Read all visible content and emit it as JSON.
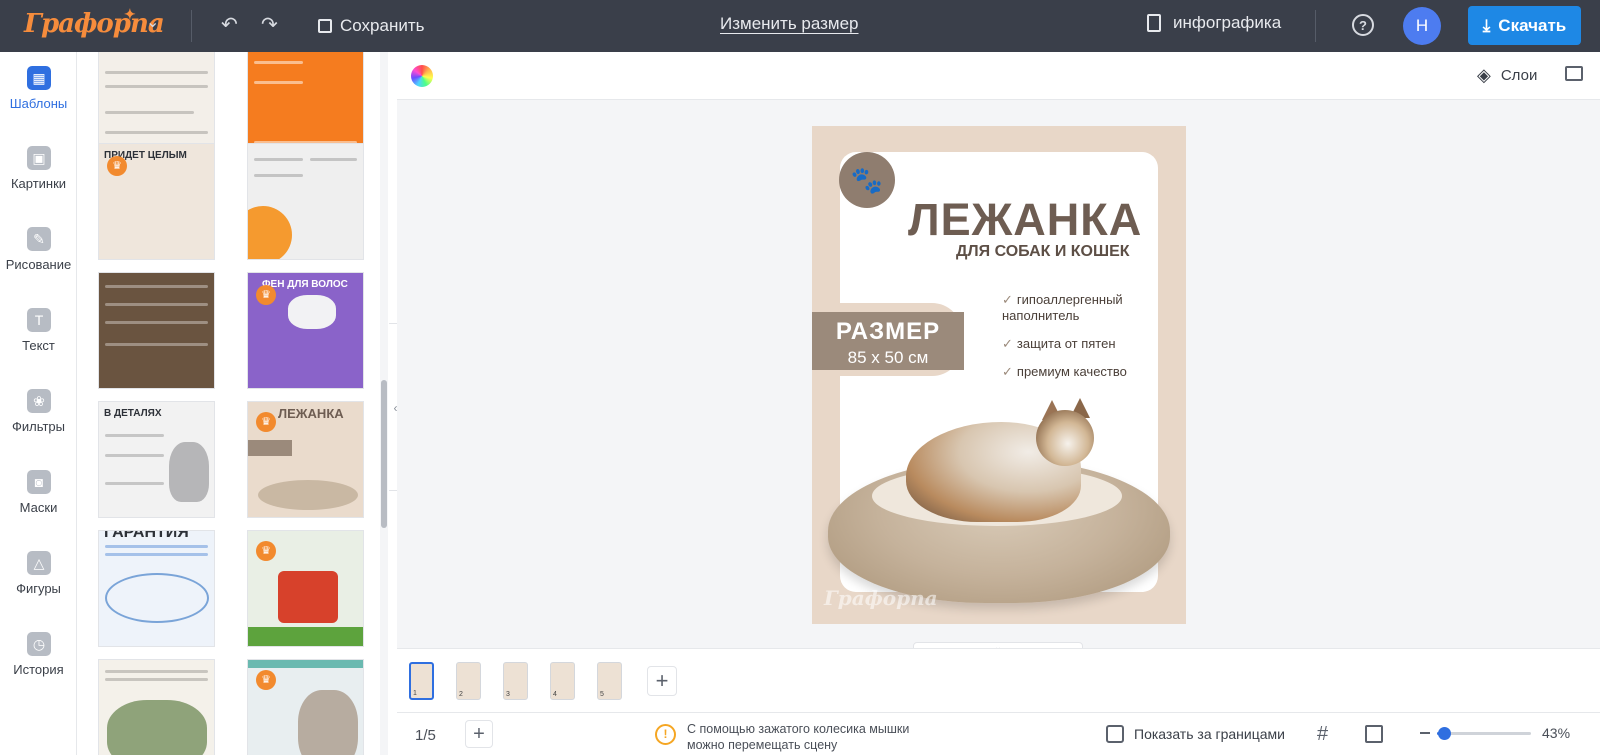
{
  "app": {
    "logo": "Графорпа",
    "save": "Сохранить",
    "resize": "Изменить размер",
    "document": "инфографика",
    "avatar_initial": "Н",
    "download": "Скачать"
  },
  "sidebar": {
    "items": [
      {
        "label": "Шаблоны",
        "icon": "templates-icon",
        "active": true
      },
      {
        "label": "Картинки",
        "icon": "image-icon",
        "active": false
      },
      {
        "label": "Рисование",
        "icon": "pencil-icon",
        "active": false
      },
      {
        "label": "Текст",
        "icon": "text-icon",
        "active": false
      },
      {
        "label": "Фильтры",
        "icon": "filters-icon",
        "active": false
      },
      {
        "label": "Маски",
        "icon": "mask-icon",
        "active": false
      },
      {
        "label": "Фигуры",
        "icon": "shapes-icon",
        "active": false
      },
      {
        "label": "История",
        "icon": "history-icon",
        "active": false
      }
    ]
  },
  "templates": [
    {
      "title": "",
      "color": "#f3efe9"
    },
    {
      "title": "",
      "color": "#f57c1f"
    },
    {
      "title": "ПРИДЕТ ЦЕЛЫМ",
      "color": "#efe6dc"
    },
    {
      "title": "",
      "color": "#efefef"
    },
    {
      "title": "",
      "color": "#6a5440"
    },
    {
      "title": "ФЕН ДЛЯ ВОЛОС",
      "color": "#8a63c9"
    },
    {
      "title": "В ДЕТАЛЯХ",
      "color": "#f2f2f2"
    },
    {
      "title": "ЛЕЖАНКА",
      "color": "#eadbcc"
    },
    {
      "title": "ГАРАНТИЯ",
      "color": "#eef3fa"
    },
    {
      "title": "",
      "color": "#e9efe5"
    },
    {
      "title": "",
      "color": "#f4f1ea"
    },
    {
      "title": "",
      "color": "#e8eef0"
    }
  ],
  "workspace": {
    "layers": "Слои"
  },
  "canvas": {
    "title": "ЛЕЖАНКА",
    "subtitle": "ДЛЯ СОБАК И КОШЕК",
    "size_label": "РАЗМЕР",
    "size_value": "85 х 50 см",
    "features": [
      "гипоаллергенный наполнитель",
      "защита от пятен",
      "премиум качество"
    ],
    "watermark": "Графорпа"
  },
  "pages": {
    "count": 5,
    "active": 1,
    "labels": [
      "1",
      "2",
      "3",
      "4",
      "5"
    ]
  },
  "status": {
    "page_counter": "1/5",
    "hint": "С помощью зажатого колесика мышки можно перемещать сцену",
    "bounds": "Показать за границами",
    "zoom": "43%",
    "zoom_level": 0.43
  },
  "colors": {
    "topbar": "#3a3f4a",
    "accent": "#2f6fe0",
    "download": "#1e88e5",
    "logo": "#f68c3c",
    "canvas_bg": "#e8d7c8",
    "brown": "#9b8a7b"
  }
}
